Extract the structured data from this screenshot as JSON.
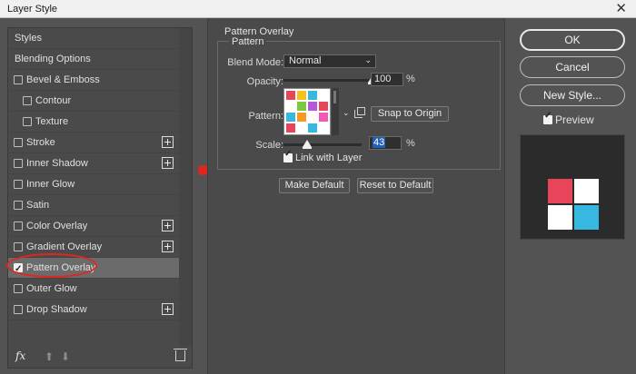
{
  "window": {
    "title": "Layer Style",
    "close_glyph": "✕"
  },
  "left": {
    "items": [
      {
        "label": "Styles",
        "checkbox": false,
        "checked": false,
        "plus": false,
        "sub": false
      },
      {
        "label": "Blending Options",
        "checkbox": false,
        "checked": false,
        "plus": false,
        "sub": false
      },
      {
        "label": "Bevel & Emboss",
        "checkbox": true,
        "checked": false,
        "plus": false,
        "sub": false
      },
      {
        "label": "Contour",
        "checkbox": true,
        "checked": false,
        "plus": false,
        "sub": true
      },
      {
        "label": "Texture",
        "checkbox": true,
        "checked": false,
        "plus": false,
        "sub": true
      },
      {
        "label": "Stroke",
        "checkbox": true,
        "checked": false,
        "plus": true,
        "sub": false
      },
      {
        "label": "Inner Shadow",
        "checkbox": true,
        "checked": false,
        "plus": true,
        "sub": false
      },
      {
        "label": "Inner Glow",
        "checkbox": true,
        "checked": false,
        "plus": false,
        "sub": false
      },
      {
        "label": "Satin",
        "checkbox": true,
        "checked": false,
        "plus": false,
        "sub": false
      },
      {
        "label": "Color Overlay",
        "checkbox": true,
        "checked": false,
        "plus": true,
        "sub": false
      },
      {
        "label": "Gradient Overlay",
        "checkbox": true,
        "checked": false,
        "plus": true,
        "sub": false
      },
      {
        "label": "Pattern Overlay",
        "checkbox": true,
        "checked": true,
        "plus": false,
        "sub": false,
        "selected": true
      },
      {
        "label": "Outer Glow",
        "checkbox": true,
        "checked": false,
        "plus": false,
        "sub": false
      },
      {
        "label": "Drop Shadow",
        "checkbox": true,
        "checked": false,
        "plus": true,
        "sub": false
      }
    ],
    "fx_label": "fx",
    "up_glyph": "⬆",
    "down_glyph": "⬇"
  },
  "pattern_overlay": {
    "section_title": "Pattern Overlay",
    "group_title": "Pattern",
    "blend_mode_label": "Blend Mode:",
    "blend_mode_value": "Normal",
    "opacity_label": "Opacity:",
    "opacity_value": "100",
    "opacity_percent": 1.0,
    "percent_sign": "%",
    "pattern_label": "Pattern:",
    "snap_button": "Snap to Origin",
    "scale_label": "Scale:",
    "scale_value": "43",
    "scale_percent": 0.1,
    "link_with_layer_label": "Link with Layer",
    "link_with_layer_checked": true,
    "make_default_button": "Make Default",
    "reset_default_button": "Reset to Default"
  },
  "right": {
    "ok_button": "OK",
    "cancel_button": "Cancel",
    "new_style_button": "New Style...",
    "preview_label": "Preview",
    "preview_checked": true
  },
  "colors": {
    "pattern_cells": [
      "#e8455a",
      "#f5c21a",
      "#36b8e0",
      "#ffffff",
      "#ffffff",
      "#7cc940",
      "#b45ad8",
      "#e8455a",
      "#36b8e0",
      "#f59a23",
      "#ffffff",
      "#f05ab4",
      "#e8455a",
      "#ffffff",
      "#36b8e0",
      "#ffffff"
    ],
    "preview_cells": [
      "#e8455a",
      "#ffffff",
      "#ffffff",
      "#36b8e0"
    ],
    "annotation_red": "#e0261f"
  }
}
